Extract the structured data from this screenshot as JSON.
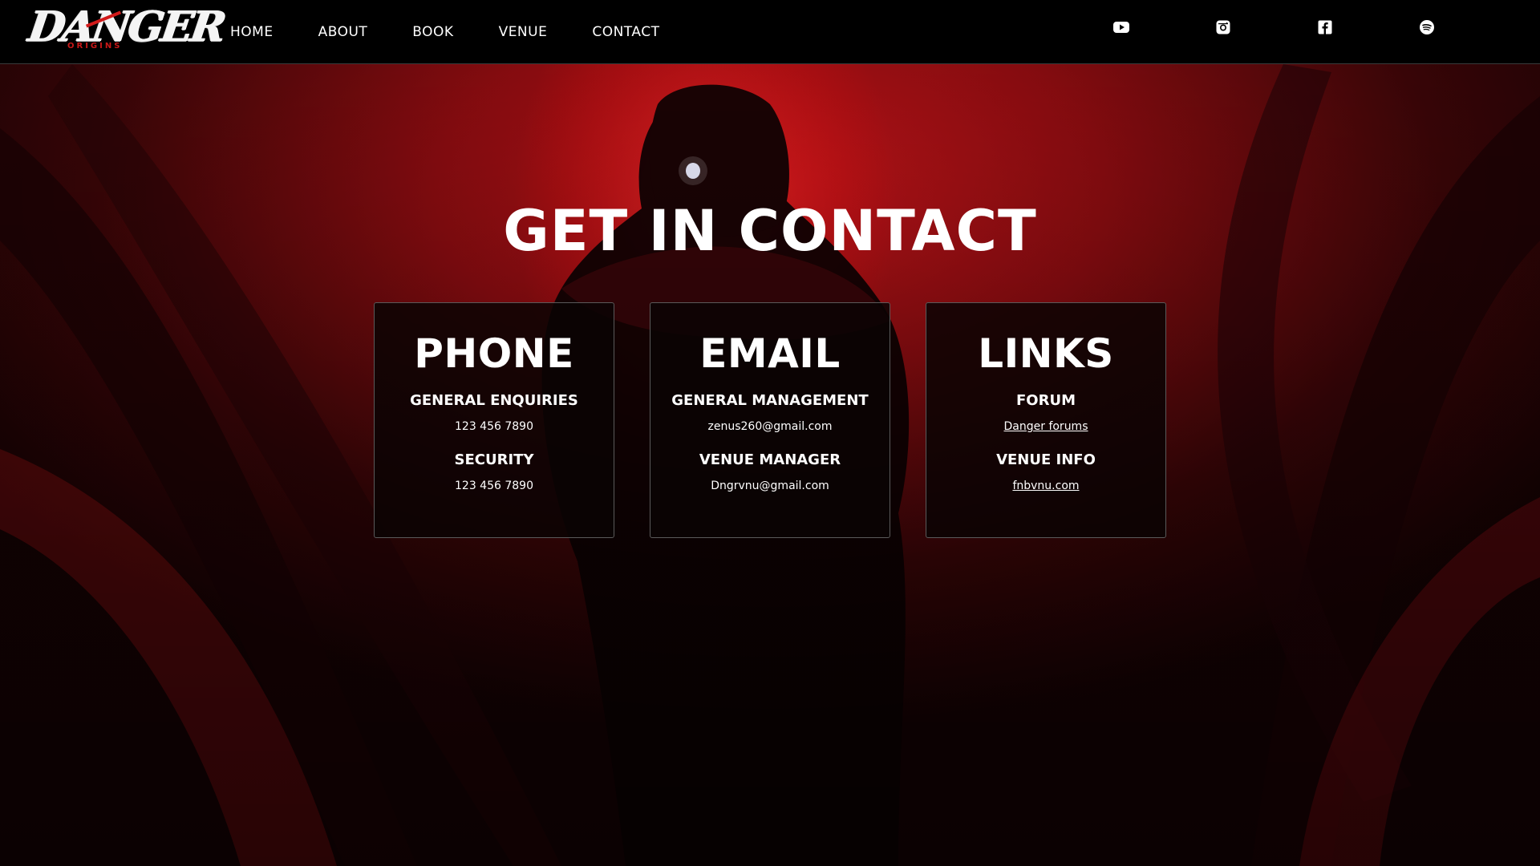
{
  "brand": {
    "logo_text": "DANGER",
    "logo_subtext": "ORIGINS"
  },
  "nav": {
    "items": [
      {
        "label": "HOME"
      },
      {
        "label": "ABOUT"
      },
      {
        "label": "BOOK"
      },
      {
        "label": "VENUE"
      },
      {
        "label": "CONTACT"
      }
    ]
  },
  "social": {
    "icons": [
      "youtube-icon",
      "instagram-icon",
      "facebook-icon",
      "spotify-icon"
    ]
  },
  "hero": {
    "title": "GET IN CONTACT"
  },
  "cards": {
    "phone": {
      "title": "PHONE",
      "entries": [
        {
          "label": "GENERAL ENQUIRIES",
          "value": "123 456 7890"
        },
        {
          "label": "SECURITY",
          "value": "123 456 7890"
        }
      ]
    },
    "email": {
      "title": "EMAIL",
      "entries": [
        {
          "label": "GENERAL MANAGEMENT",
          "value": "zenus260@gmail.com"
        },
        {
          "label": "VENUE MANAGER",
          "value": "Dngrvnu@gmail.com"
        }
      ]
    },
    "links": {
      "title": "LINKS",
      "entries": [
        {
          "label": "FORUM",
          "value": "Danger forums"
        },
        {
          "label": "VENUE INFO",
          "value": "fnbvnu.com"
        }
      ]
    }
  },
  "colors": {
    "accent_red": "#c81818",
    "background_dark": "#000000",
    "card_bg": "#0a0304"
  }
}
